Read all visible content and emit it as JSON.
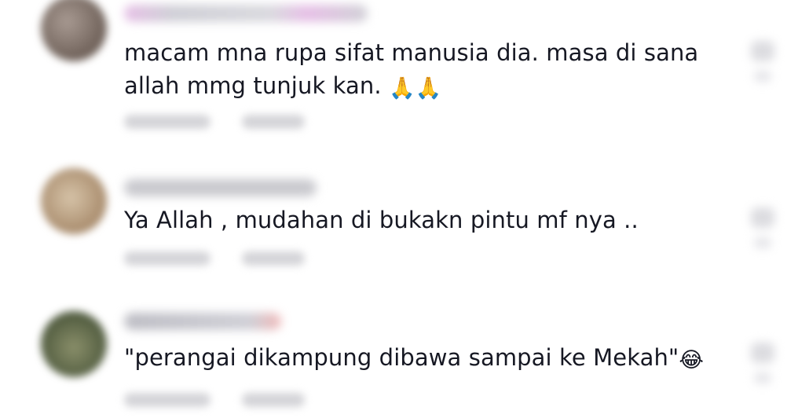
{
  "comments": [
    {
      "text": "macam mna rupa sifat manusia dia. masa di sana\nallah mmg tunjuk kan. ",
      "emoji": "🙏🙏",
      "emoji_icon": "folded-hands-icon"
    },
    {
      "text": "Ya Allah , mudahan di bukakn pintu mf nya ..",
      "emoji": "",
      "emoji_icon": ""
    },
    {
      "text": "\"perangai dikampung dibawa sampai ke Mekah\"",
      "emoji": "😂",
      "emoji_icon": "face-with-tears-of-joy-icon"
    }
  ],
  "colors": {
    "text": "#161823",
    "background": "#ffffff",
    "blurred_placeholder": "#c9c9ce"
  }
}
